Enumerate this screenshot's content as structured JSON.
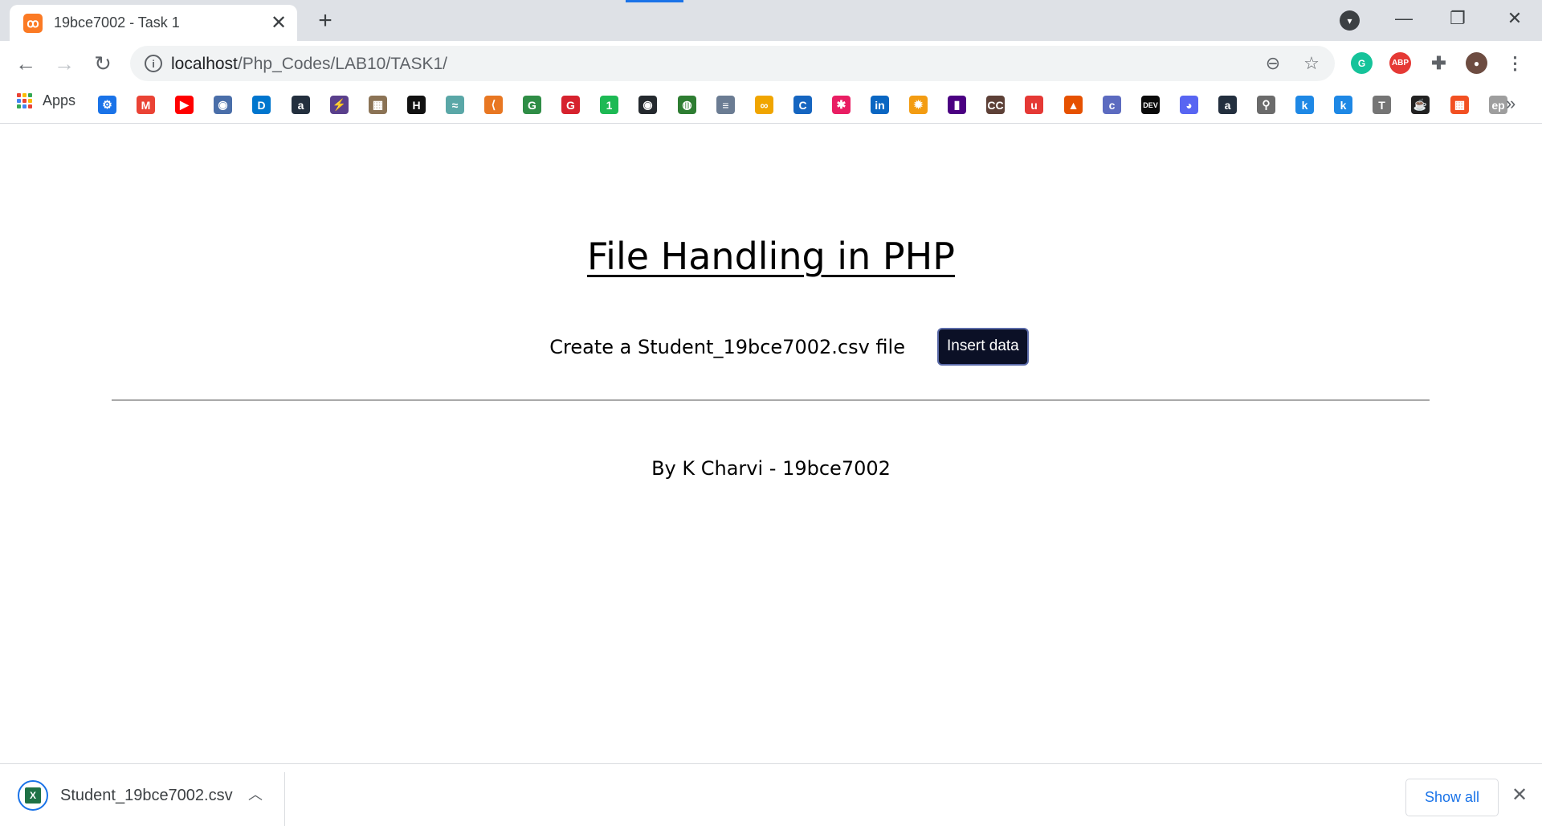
{
  "browser": {
    "tab": {
      "title": "19bce7002 - Task 1",
      "favicon": "xampp-icon"
    },
    "url": {
      "host": "localhost",
      "path": "/Php_Codes/LAB10/TASK1/"
    },
    "bookmarks_bar": {
      "apps_label": "Apps",
      "bookmarks": [
        {
          "name": "settings",
          "glyph": "⚙",
          "color": "#1a73e8"
        },
        {
          "name": "gmail",
          "glyph": "M",
          "color": "#ea4335"
        },
        {
          "name": "youtube",
          "glyph": "▶",
          "color": "#ff0000"
        },
        {
          "name": "shield",
          "glyph": "◉",
          "color": "#4a6ea9"
        },
        {
          "name": "dell",
          "glyph": "D",
          "color": "#0076ce"
        },
        {
          "name": "amazon",
          "glyph": "a",
          "color": "#232f3e"
        },
        {
          "name": "bolt",
          "glyph": "⚡",
          "color": "#5a3f8c"
        },
        {
          "name": "image",
          "glyph": "▦",
          "color": "#8b7355"
        },
        {
          "name": "hackerrank",
          "glyph": "H",
          "color": "#111111"
        },
        {
          "name": "wave",
          "glyph": "≈",
          "color": "#5aa7a7"
        },
        {
          "name": "edge",
          "glyph": "⟨",
          "color": "#e87722"
        },
        {
          "name": "geeksforgeeks",
          "glyph": "G",
          "color": "#2f8d46"
        },
        {
          "name": "g-red",
          "glyph": "G",
          "color": "#d6222e"
        },
        {
          "name": "one",
          "glyph": "1",
          "color": "#1db954"
        },
        {
          "name": "github",
          "glyph": "◉",
          "color": "#24292e"
        },
        {
          "name": "circle-green",
          "glyph": "◍",
          "color": "#2e7d32"
        },
        {
          "name": "stack",
          "glyph": "≡",
          "color": "#6b7c93"
        },
        {
          "name": "coursera-co",
          "glyph": "∞",
          "color": "#f0a500"
        },
        {
          "name": "c-blue",
          "glyph": "C",
          "color": "#1565c0"
        },
        {
          "name": "asterisk",
          "glyph": "✱",
          "color": "#e91e63"
        },
        {
          "name": "linkedin",
          "glyph": "in",
          "color": "#0a66c2"
        },
        {
          "name": "sun",
          "glyph": "✹",
          "color": "#f39c12"
        },
        {
          "name": "purple-chart",
          "glyph": "▮",
          "color": "#4b0082"
        },
        {
          "name": "cc",
          "glyph": "CC",
          "color": "#5d4037"
        },
        {
          "name": "udemy",
          "glyph": "u",
          "color": "#e53935"
        },
        {
          "name": "matlab",
          "glyph": "▲",
          "color": "#e65100"
        },
        {
          "name": "c-circle",
          "glyph": "c",
          "color": "#5c6bc0"
        },
        {
          "name": "dev",
          "glyph": "DEV",
          "color": "#0a0a0a"
        },
        {
          "name": "discord",
          "glyph": "◕",
          "color": "#5865f2"
        },
        {
          "name": "amazon-2",
          "glyph": "a",
          "color": "#232f3e"
        },
        {
          "name": "search",
          "glyph": "⚲",
          "color": "#6b6b6b"
        },
        {
          "name": "k-blue",
          "glyph": "k",
          "color": "#1e88e5"
        },
        {
          "name": "k-blue-2",
          "glyph": "k",
          "color": "#1e88e5"
        },
        {
          "name": "t-grey",
          "glyph": "T",
          "color": "#757575"
        },
        {
          "name": "cup",
          "glyph": "☕",
          "color": "#222222"
        },
        {
          "name": "microsoft",
          "glyph": "▦",
          "color": "#f25022"
        },
        {
          "name": "ep",
          "glyph": "ep",
          "color": "#9e9e9e"
        }
      ]
    }
  },
  "page": {
    "heading": "File Handling in PHP",
    "create_label": "Create a Student_19bce7002.csv file",
    "insert_button": "Insert data",
    "footer": "By K Charvi - 19bce7002"
  },
  "downloads": {
    "file_name": "Student_19bce7002.csv",
    "show_all": "Show all"
  },
  "colors": {
    "button_bg": "#0b1026",
    "link_blue": "#1a73e8",
    "tab_strip": "#dee1e6"
  }
}
